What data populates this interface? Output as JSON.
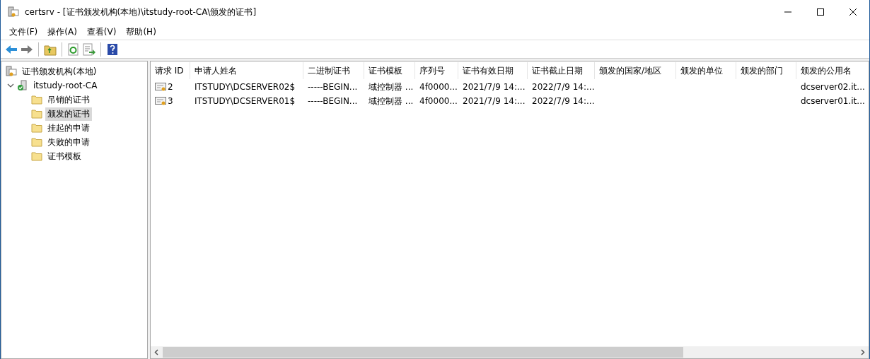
{
  "window": {
    "title": "certsrv - [证书颁发机构(本地)\\itstudy-root-CA\\颁发的证书]"
  },
  "menu": [
    "文件(F)",
    "操作(A)",
    "查看(V)",
    "帮助(H)"
  ],
  "tree": [
    {
      "label": "证书颁发机构(本地)",
      "kind": "root",
      "selected": false,
      "children": [
        {
          "label": "itstudy-root-CA",
          "kind": "ca",
          "expanded": true,
          "selected": false,
          "children": [
            {
              "label": "吊销的证书",
              "kind": "folder",
              "selected": false
            },
            {
              "label": "颁发的证书",
              "kind": "folder",
              "selected": true
            },
            {
              "label": "挂起的申请",
              "kind": "folder",
              "selected": false
            },
            {
              "label": "失败的申请",
              "kind": "folder",
              "selected": false
            },
            {
              "label": "证书模板",
              "kind": "folder",
              "selected": false
            }
          ]
        }
      ]
    }
  ],
  "table": {
    "columns": [
      "请求 ID",
      "申请人姓名",
      "二进制证书",
      "证书模板",
      "序列号",
      "证书有效日期",
      "证书截止日期",
      "颁发的国家/地区",
      "颁发的单位",
      "颁发的部门",
      "颁发的公用名"
    ],
    "rows": [
      [
        "2",
        "ITSTUDY\\DCSERVER02$",
        "-----BEGIN...",
        "域控制器 ...",
        "4f0000...",
        "2021/7/9 14:...",
        "2022/7/9 14:...",
        "",
        "",
        "",
        "dcserver02.it..."
      ],
      [
        "3",
        "ITSTUDY\\DCSERVER01$",
        "-----BEGIN...",
        "域控制器 ...",
        "4f0000...",
        "2021/7/9 14:...",
        "2022/7/9 14:...",
        "",
        "",
        "",
        "dcserver01.it..."
      ]
    ]
  }
}
